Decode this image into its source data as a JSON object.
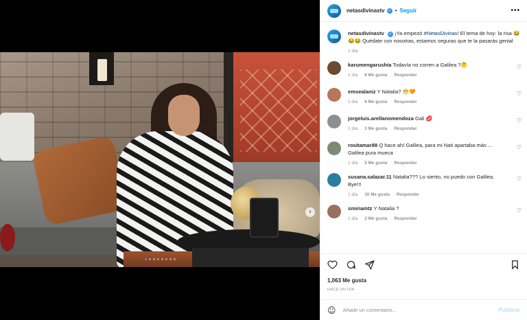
{
  "post": {
    "username": "netasdivinastv",
    "separator": "•",
    "follow_label": "Seguir",
    "more_label": "•••",
    "caption_pre": "¡Ya empezó ",
    "caption_tag": "#NetasDivinas",
    "caption_post": "! El tema de hoy: la risa 😂😂😂 Quédate con nosotras, estamos seguras que te la pasarás genial",
    "caption_time": "1 día"
  },
  "comments": [
    {
      "username": "karumengarushia",
      "text": "Todavía no corren a Galilea ?🤔",
      "time": "1 día",
      "likes": "6 Me gusta",
      "reply": "Responder",
      "avatar_color": "#6b4a2f"
    },
    {
      "username": "emsealaniz",
      "text": "Y Natalia? 😁🧡",
      "time": "1 día",
      "likes": "6 Me gusta",
      "reply": "Responder",
      "avatar_color": "#b8765a"
    },
    {
      "username": "jorgeluis.arellanomendoza",
      "text": "Gali 💋",
      "time": "1 día",
      "likes": "3 Me gusta",
      "reply": "Responder",
      "avatar_color": "#8a8f93"
    },
    {
      "username": "rositamar88",
      "text": "Q hace ahí Galilea, para mi Nati apartaba más ... Galilea pura mueca",
      "time": "1 día",
      "likes": "5 Me gusta",
      "reply": "Responder",
      "avatar_color": "#7d8a76"
    },
    {
      "username": "susana.salazar.11",
      "text": "Natalia??? Lo siento, no puedo con Galilea. Bye!!!",
      "time": "1 día",
      "likes": "10 Me gusta",
      "reply": "Responder",
      "avatar_color": "#2a7fa0"
    },
    {
      "username": "smiriamtz",
      "text": "Y Natalia ?",
      "time": "1 día",
      "likes": "2 Me gusta",
      "reply": "Responder",
      "avatar_color": "#9a7060"
    }
  ],
  "actions": {
    "likes": "1,063 Me gusta",
    "time_ago": "HACE UN DÍA"
  },
  "add_comment": {
    "placeholder": "Añade un comentario...",
    "publish_label": "Publicar",
    "emoji_icon": "☺"
  },
  "icons": {
    "heart": "♡",
    "verified": "✓",
    "next": "›"
  },
  "carousel": {
    "count": 8,
    "active_index": 0
  }
}
